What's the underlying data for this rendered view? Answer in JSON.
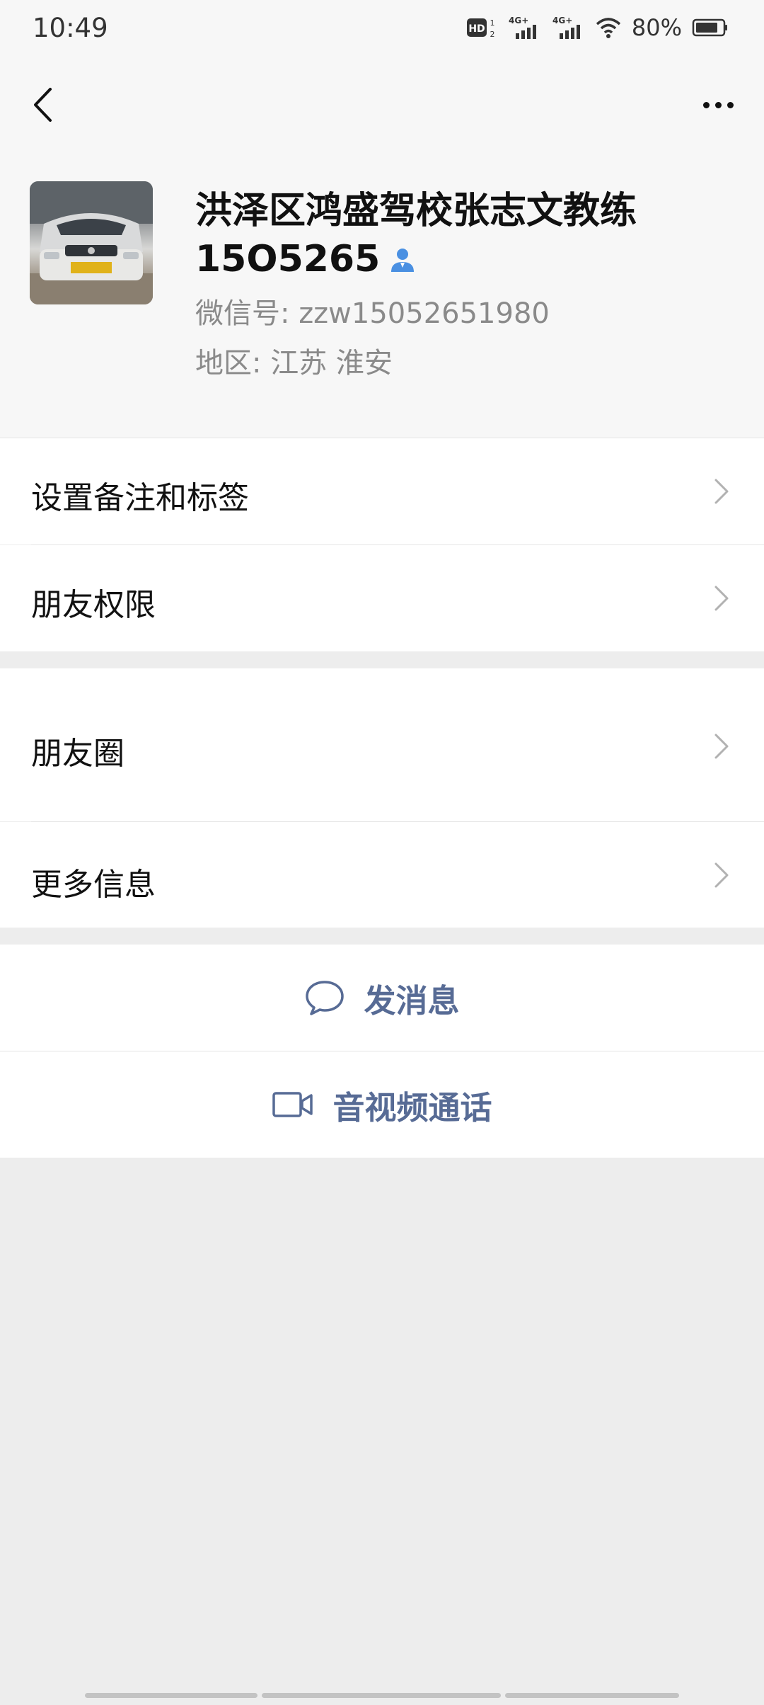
{
  "status_bar": {
    "time": "10:49",
    "network_1": "4G+",
    "network_2": "4G+",
    "battery": "80%",
    "hd_label": "HD"
  },
  "nav": {
    "back_icon": "chevron-left-icon",
    "more_icon": "ellipsis-icon"
  },
  "profile": {
    "name": "洪泽区鸿盛驾校张志文教练15O5265",
    "wechat_id": "微信号: zzw15052651980",
    "region": "地区: 江苏  淮安"
  },
  "list": {
    "remark_tags": "设置备注和标签",
    "friend_permissions": "朋友权限",
    "moments": "朋友圈",
    "more_info": "更多信息"
  },
  "actions": {
    "send_message": "发消息",
    "voice_video_call": "音视频通话"
  },
  "colors": {
    "link_blue": "#576b95",
    "background": "#ededed",
    "person_icon": "#4a90e2"
  }
}
